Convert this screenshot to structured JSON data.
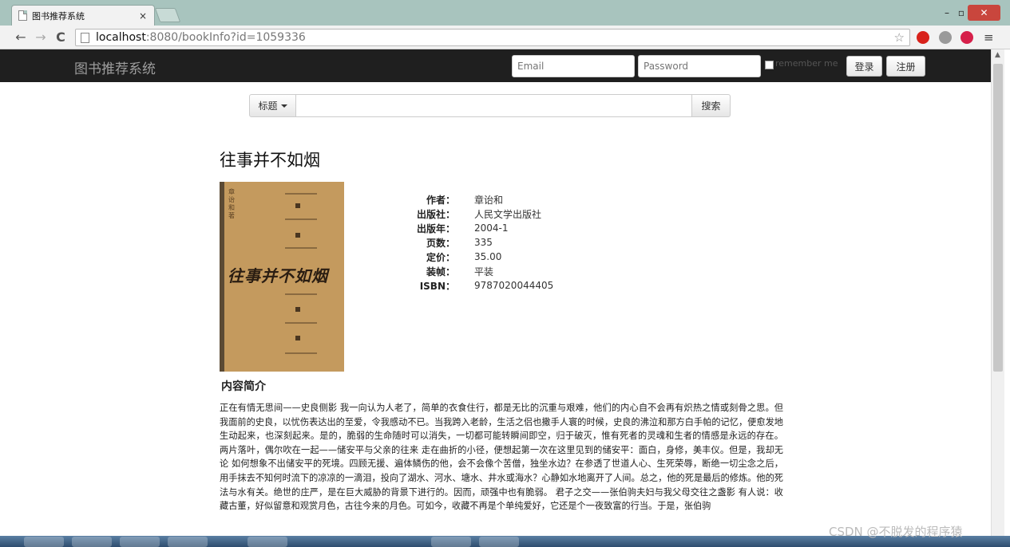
{
  "browser": {
    "tab_title": "图书推荐系统",
    "tab_close": "×",
    "url_host": "localhost",
    "url_rest": ":8080/bookInfo?id=1059336",
    "window_controls": {
      "minimize": "–",
      "maximize": "▫",
      "close": "✕"
    }
  },
  "navbar": {
    "brand": "图书推荐系统",
    "email_placeholder": "Email",
    "password_placeholder": "Password",
    "remember_label": "remember me",
    "login_label": "登录",
    "register_label": "注册"
  },
  "search": {
    "type_label": "标题",
    "button_label": "搜索"
  },
  "book": {
    "title": "往事并不如烟",
    "cover_author": "章诒和 著",
    "cover_title": "往事并不如烟",
    "fields": [
      {
        "label": "作者：",
        "value": "章诒和"
      },
      {
        "label": "出版社：",
        "value": "人民文学出版社"
      },
      {
        "label": "出版年：",
        "value": "2004-1"
      },
      {
        "label": "页数：",
        "value": "335"
      },
      {
        "label": "定价：",
        "value": "35.00"
      },
      {
        "label": "装帧：",
        "value": "平装"
      },
      {
        "label": "ISBN：",
        "value": "9787020044405"
      }
    ],
    "intro_heading": "内容简介",
    "intro_text": "正在有情无思间——史良侧影 我一向认为人老了，简单的衣食住行，都是无比的沉重与艰难，他们的内心自不会再有炽热之情或刻骨之思。但我面前的史良，以忧伤表达出的至爱，令我感动不已。当我跨入老龄，生活之侣也撒手人寰的时候，史良的沸泣和那方白手帕的记忆，便愈发地生动起来，也深刻起来。是的，脆弱的生命随时可以消失，一切都可能转瞬间即空，归于破灭，惟有死者的灵魂和生者的情感是永远的存在。 两片落叶，偶尔吹在一起——储安平与父亲的往来 走在曲折的小径，便想起第一次在这里见到的储安平：面白，身修，美丰仪。但是，我却无论 如何想象不出储安平的死境。四顾无援、遍体鳞伤的他，会不会像个苦僧，独坐水边？在参透了世道人心、生死荣辱，断绝一切尘念之后，用手抹去不知何时流下的凉凉的一滴泪，投向了湖水、河水、塘水、井水或海水？心静如水地离开了人间。总之，他的死是最后的修炼。他的死法与水有关。绝世的庄严，是在巨大威胁的背景下进行的。因而，顽强中也有脆弱。 君子之交——张伯驹夫妇与我父母交往之盏影 有人说：收藏古董，好似留意和观赏月色，古往今来的月色。可如今，收藏不再是个单纯爱好，它还是个一夜致富的行当。于是，张伯驹"
  },
  "watermark": "CSDN @不脱发的程序猿"
}
